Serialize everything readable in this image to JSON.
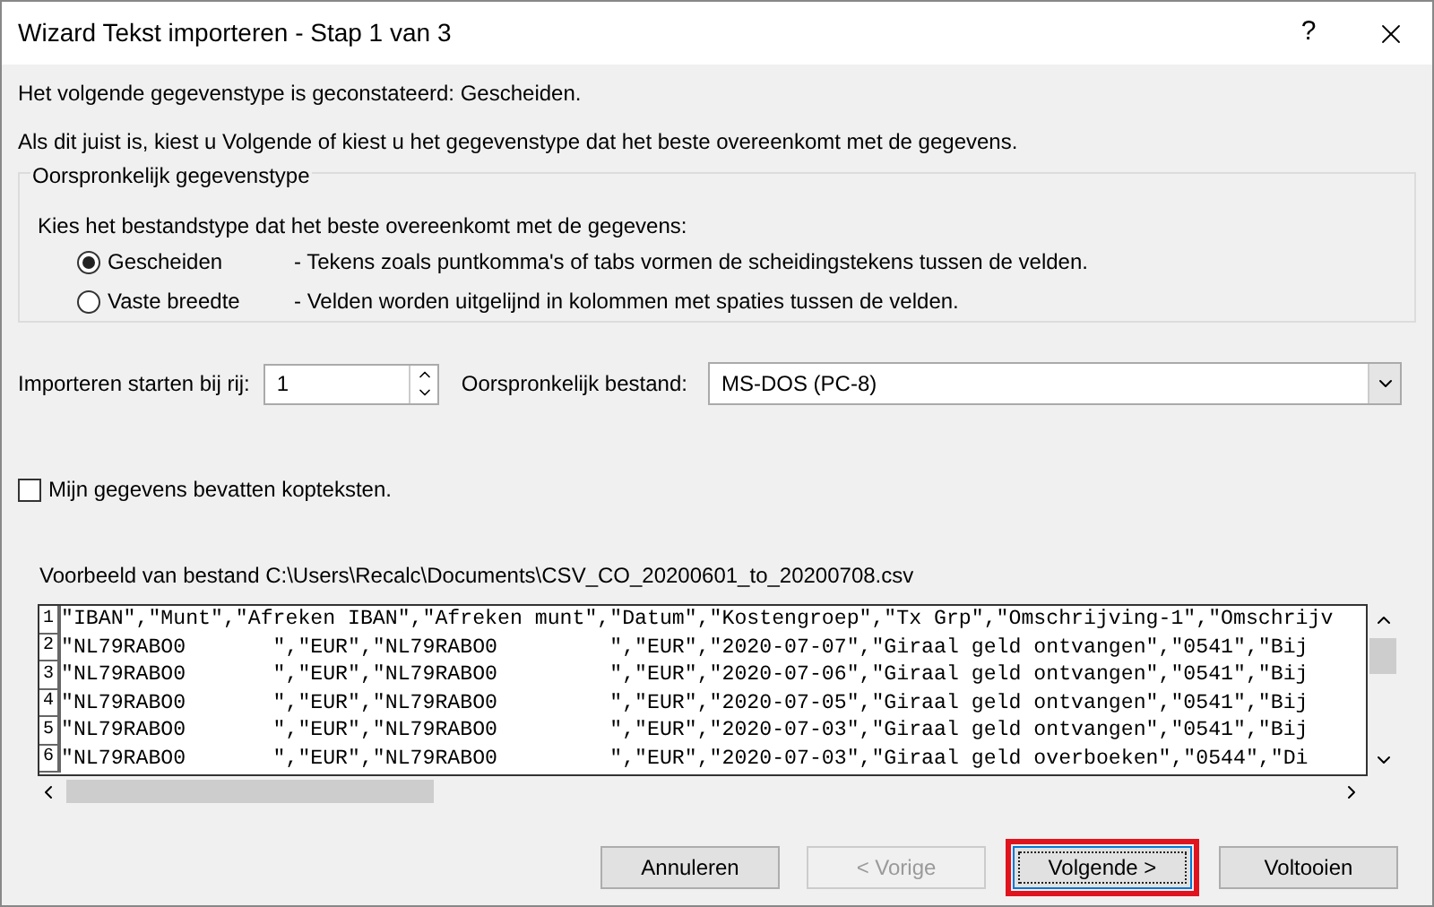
{
  "window": {
    "title": "Wizard Tekst importeren - Stap 1 van 3",
    "help": "?"
  },
  "intro": [
    "Het volgende gegevenstype is geconstateerd: Gescheiden.",
    "Als dit juist is, kiest u Volgende of kiest u het gegevenstype dat het beste overeenkomt met de gegevens."
  ],
  "data_type_group": {
    "title": "Oorspronkelijk gegevenstype",
    "prompt": "Kies het bestandstype dat het beste overeenkomt met de gegevens:",
    "options": [
      {
        "label": "Gescheiden",
        "description": "- Tekens zoals puntkomma's of tabs vormen de scheidingstekens tussen de velden.",
        "selected": true
      },
      {
        "label": "Vaste breedte",
        "description": "- Velden worden uitgelijnd in kolommen met spaties tussen de velden.",
        "selected": false
      }
    ]
  },
  "start_row": {
    "label": "Importeren starten bij rij:",
    "value": "1"
  },
  "origin": {
    "label": "Oorspronkelijk bestand:",
    "value": "MS-DOS (PC-8)"
  },
  "headers_checkbox": {
    "label": "Mijn gegevens bevatten kopteksten.",
    "checked": false
  },
  "preview": {
    "label": "Voorbeeld van bestand C:\\Users\\Recalc\\Documents\\CSV_CO_20200601_to_20200708.csv",
    "rows": [
      {
        "number": "1",
        "text": "\"IBAN\",\"Munt\",\"Afreken IBAN\",\"Afreken munt\",\"Datum\",\"Kostengroep\",\"Tx Grp\",\"Omschrijving-1\",\"Omschrijv"
      },
      {
        "number": "2",
        "text": "\"NL79RABO0       \",\"EUR\",\"NL79RABO0         \",\"EUR\",\"2020-07-07\",\"Giraal geld ontvangen\",\"0541\",\"Bij"
      },
      {
        "number": "3",
        "text": "\"NL79RABO0       \",\"EUR\",\"NL79RABO0         \",\"EUR\",\"2020-07-06\",\"Giraal geld ontvangen\",\"0541\",\"Bij"
      },
      {
        "number": "4",
        "text": "\"NL79RABO0       \",\"EUR\",\"NL79RABO0         \",\"EUR\",\"2020-07-05\",\"Giraal geld ontvangen\",\"0541\",\"Bij"
      },
      {
        "number": "5",
        "text": "\"NL79RABO0       \",\"EUR\",\"NL79RABO0         \",\"EUR\",\"2020-07-03\",\"Giraal geld ontvangen\",\"0541\",\"Bij"
      },
      {
        "number": "6",
        "text": "\"NL79RABO0       \",\"EUR\",\"NL79RABO0         \",\"EUR\",\"2020-07-03\",\"Giraal geld overboeken\",\"0544\",\"Di"
      }
    ]
  },
  "buttons": [
    {
      "label": "Annuleren",
      "disabled": false,
      "focused": false,
      "highlighted": false
    },
    {
      "label": "< Vorige",
      "disabled": true,
      "focused": false,
      "highlighted": false
    },
    {
      "label": "Volgende >",
      "disabled": false,
      "focused": true,
      "highlighted": true
    },
    {
      "label": "Voltooien",
      "disabled": false,
      "focused": false,
      "highlighted": false
    }
  ]
}
